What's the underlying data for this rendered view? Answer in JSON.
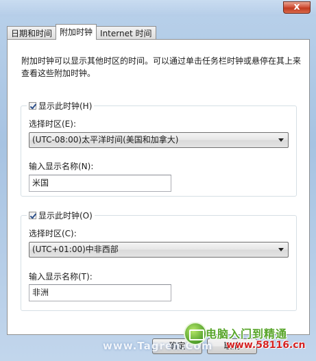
{
  "window": {
    "close_symbol": "x"
  },
  "tabs": [
    {
      "label": "日期和时间",
      "active": false
    },
    {
      "label": "附加时钟",
      "active": true
    },
    {
      "label": "Internet 时间",
      "active": false
    }
  ],
  "description": "附加时钟可以显示其他时区的时间。可以通过单击任务栏时钟或悬停在其上来查看这些附加时钟。",
  "clock1": {
    "checkbox_label": "显示此时钟(H)",
    "checked": true,
    "timezone_label": "选择时区(E):",
    "timezone_value": "(UTC-08:00)太平洋时间(美国和加拿大)",
    "name_label": "输入显示名称(N):",
    "name_value": "米国"
  },
  "clock2": {
    "checkbox_label": "显示此时钟(O)",
    "checked": true,
    "timezone_label": "选择时区(C):",
    "timezone_value": "(UTC+01:00)中非西部",
    "name_label": "输入显示名称(T):",
    "name_value": "非洲"
  },
  "buttons": {
    "ok": "确定",
    "cancel": "取消"
  },
  "watermark": {
    "left_text": "www.Tagren.Com",
    "title": "电脑入门到精通",
    "url": "www.58116.cn"
  },
  "colors": {
    "title_bar": "#b9d1ea",
    "close_button": "#c13b20",
    "watermark_green": "#58a52a",
    "watermark_red": "#d32222"
  },
  "icons": {
    "close": "close-icon",
    "dropdown": "chevron-down-icon",
    "checkbox": "checkmark-icon",
    "logo": "computer-logo-icon"
  }
}
